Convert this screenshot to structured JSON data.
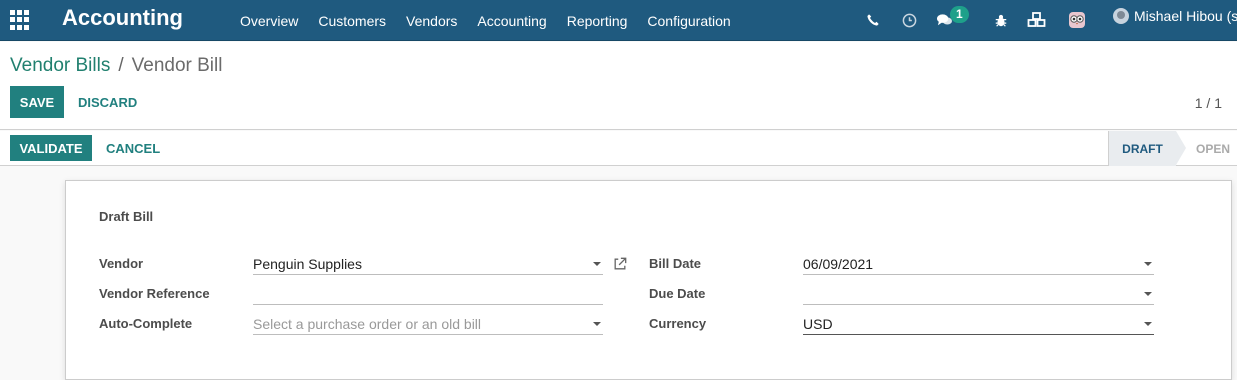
{
  "navbar": {
    "brand": "Accounting",
    "menu": [
      "Overview",
      "Customers",
      "Vendors",
      "Accounting",
      "Reporting",
      "Configuration"
    ],
    "messages_count": "1",
    "user_name": "Mishael Hibou (s"
  },
  "breadcrumb": {
    "parent": "Vendor Bills",
    "separator": "/",
    "current": "Vendor Bill"
  },
  "actions": {
    "save": "SAVE",
    "discard": "DISCARD",
    "pager": "1 / 1"
  },
  "statusbar": {
    "validate": "VALIDATE",
    "cancel": "CANCEL",
    "stages": {
      "draft": "DRAFT",
      "open": "OPEN"
    },
    "active_stage": "DRAFT"
  },
  "form": {
    "title": "Draft Bill",
    "vendor_label": "Vendor",
    "vendor_value": "Penguin Supplies",
    "vendor_reference_label": "Vendor Reference",
    "vendor_reference_value": "",
    "auto_complete_label": "Auto-Complete",
    "auto_complete_placeholder": "Select a purchase order or an old bill",
    "bill_date_label": "Bill Date",
    "bill_date_value": "06/09/2021",
    "due_date_label": "Due Date",
    "due_date_value": "",
    "currency_label": "Currency",
    "currency_value": "USD"
  },
  "colors": {
    "navbar": "#1f5a7f",
    "primary": "#21807f",
    "badge": "#1ea08a"
  }
}
